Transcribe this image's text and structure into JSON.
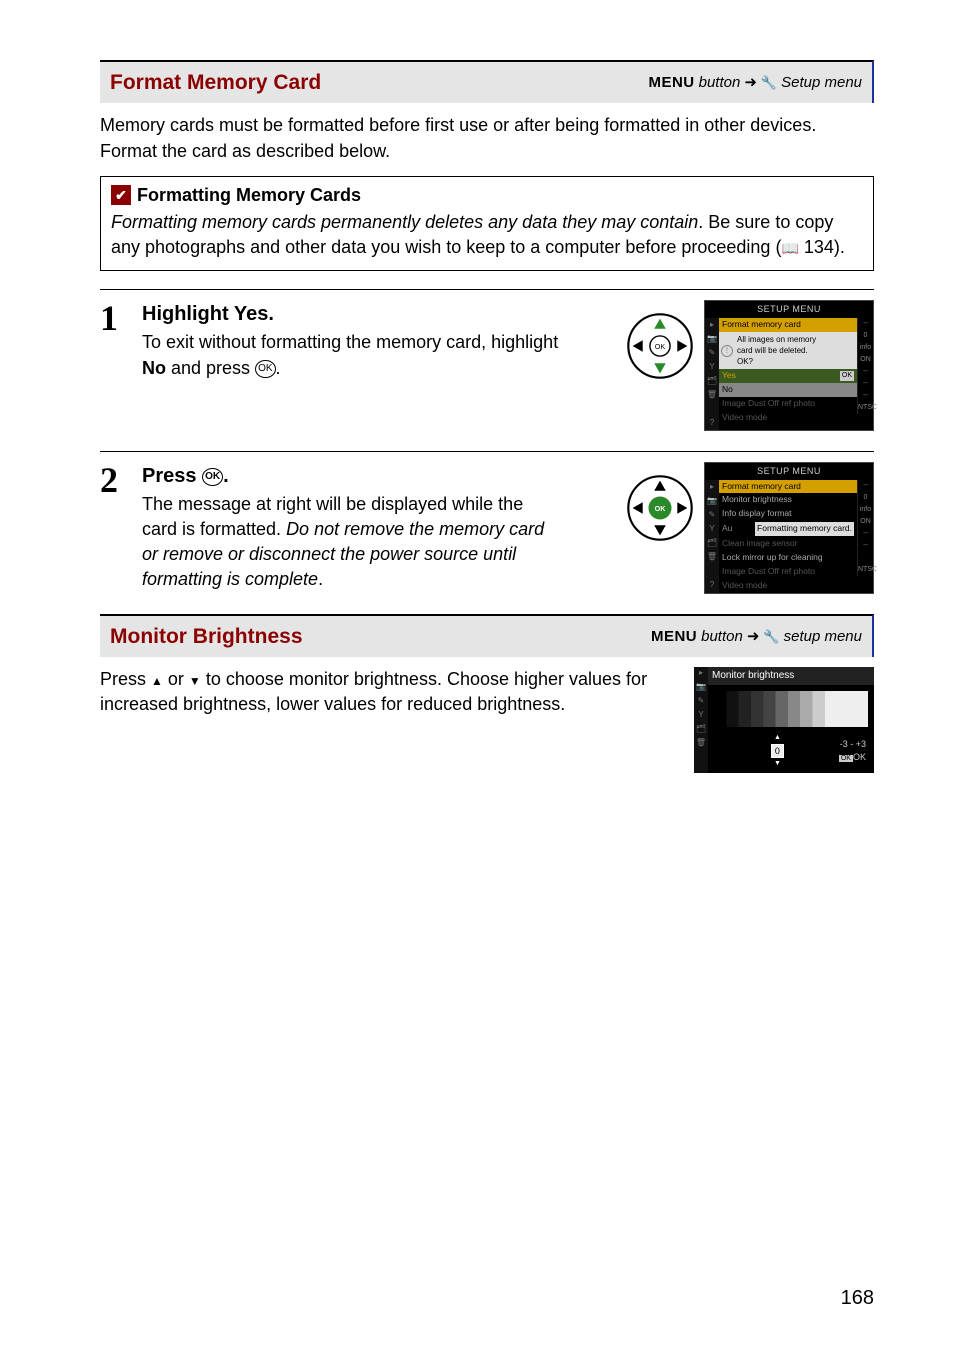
{
  "section1": {
    "title": "Format Memory Card",
    "path_menu": "MENU",
    "path_button": " button ",
    "path_tail": " Setup menu",
    "intro": "Memory cards must be formatted before first use or after being formatted in other devices.  Format the card as described below."
  },
  "note": {
    "icon_text": "✔",
    "heading": "Formatting Memory Cards",
    "body_italic": "Formatting memory cards permanently deletes any data they may contain",
    "body_rest": ".  Be sure to copy any photographs and other data you wish to keep to a computer before proceeding (",
    "page_ref": " 134)."
  },
  "steps": [
    {
      "num": "1",
      "heading_prefix": "Highlight ",
      "heading_bold": "Yes",
      "heading_suffix": ".",
      "text_a": "To exit without formatting the memory card, highlight ",
      "text_bold": "No",
      "text_b": " and press ",
      "text_c": ".",
      "lcd": {
        "title": "SETUP MENU",
        "top_row": "Format memory card",
        "dialog_l1": "All images on memory",
        "dialog_l2": "card will be deleted.",
        "dialog_l3": "OK?",
        "yes": "Yes",
        "no": "No",
        "dim1": "Image Dust Off ref photo",
        "dim2": "Video mode",
        "right": [
          "--",
          "0",
          "info",
          "ON",
          "--",
          "--",
          "--",
          "NTSC"
        ]
      }
    },
    {
      "num": "2",
      "heading_prefix": "Press ",
      "heading_suffix": ".",
      "text_a": "The message at right will be displayed while the card is formatted.  ",
      "text_italic": "Do not remove the memory card or remove or disconnect the power source until formatting is complete",
      "text_b": ".",
      "lcd": {
        "title": "SETUP MENU",
        "rows": [
          {
            "label": "Format memory card",
            "val": "--",
            "hl": true
          },
          {
            "label": "Monitor brightness",
            "val": "0"
          },
          {
            "label": "Info display format",
            "val": "info"
          },
          {
            "label": "  Formatting memory card.",
            "val": "ON",
            "popup": true,
            "prefix": "Au"
          },
          {
            "label": "Clean image sensor",
            "val": "--"
          },
          {
            "label": "Lock mirror up for cleaning",
            "val": "--"
          },
          {
            "label": "Image Dust Off ref photo",
            "val": "",
            "dim": true
          },
          {
            "label": "Video mode",
            "val": "NTSC"
          }
        ]
      }
    }
  ],
  "section2": {
    "title": "Monitor Brightness",
    "path_menu": "MENU",
    "path_button": " button ",
    "path_tail": " setup menu",
    "text_a": "Press ",
    "text_b": " or ",
    "text_c": " to choose monitor brightness.  Choose higher values for increased brightness, lower values for reduced brightness.",
    "lcd": {
      "title": "Monitor brightness",
      "zero": "0",
      "scale": "-3 - +3",
      "ok": "OK"
    }
  },
  "page_number": "168"
}
